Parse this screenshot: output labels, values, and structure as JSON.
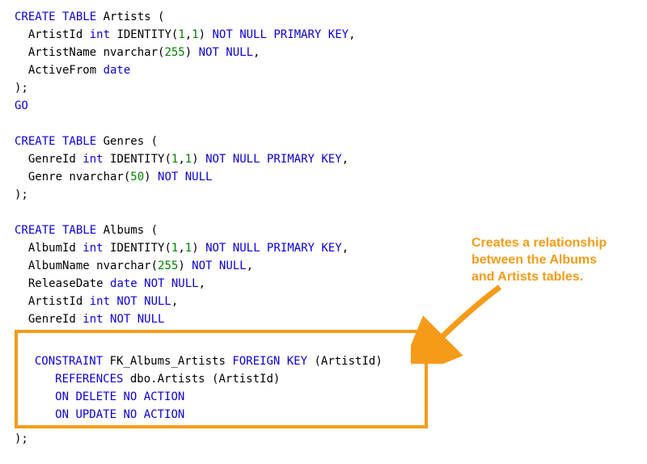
{
  "code": {
    "l1": {
      "a": "CREATE TABLE",
      "b": " Artists ("
    },
    "l2": {
      "a": "  ArtistId ",
      "b": "int",
      "c": " IDENTITY(",
      "d": "1",
      "e": ",",
      "f": "1",
      "g": ") ",
      "h": "NOT NULL PRIMARY KEY",
      "i": ","
    },
    "l3": {
      "a": "  ArtistName nvarchar(",
      "b": "255",
      "c": ") ",
      "d": "NOT NULL",
      "e": ","
    },
    "l4": {
      "a": "  ActiveFrom ",
      "b": "date"
    },
    "l5": ");",
    "l6": "GO",
    "blank1": " ",
    "l7": {
      "a": "CREATE TABLE",
      "b": " Genres ("
    },
    "l8": {
      "a": "  GenreId ",
      "b": "int",
      "c": " IDENTITY(",
      "d": "1",
      "e": ",",
      "f": "1",
      "g": ") ",
      "h": "NOT NULL PRIMARY KEY",
      "i": ","
    },
    "l9": {
      "a": "  Genre nvarchar(",
      "b": "50",
      "c": ") ",
      "d": "NOT NULL"
    },
    "l10": ");",
    "blank2": " ",
    "l11": {
      "a": "CREATE TABLE",
      "b": " Albums ("
    },
    "l12": {
      "a": "  AlbumId ",
      "b": "int",
      "c": " IDENTITY(",
      "d": "1",
      "e": ",",
      "f": "1",
      "g": ") ",
      "h": "NOT NULL PRIMARY KEY",
      "i": ","
    },
    "l13": {
      "a": "  AlbumName nvarchar(",
      "b": "255",
      "c": ") ",
      "d": "NOT NULL",
      "e": ","
    },
    "l14": {
      "a": "  ReleaseDate ",
      "b": "date NOT NULL",
      "c": ","
    },
    "l15": {
      "a": "  ArtistId ",
      "b": "int NOT NULL",
      "c": ","
    },
    "l16": {
      "a": "  GenreId ",
      "b": "int NOT NULL"
    },
    "blank3": " ",
    "l17": {
      "a": "  ",
      "b": "CONSTRAINT",
      "c": " FK_Albums_Artists ",
      "d": "FOREIGN KEY",
      "e": " (ArtistId)"
    },
    "l18": {
      "a": "     ",
      "b": "REFERENCES",
      "c": " dbo.Artists (ArtistId)"
    },
    "l19": {
      "a": "     ",
      "b": "ON DELETE NO ACTION"
    },
    "l20": {
      "a": "     ",
      "b": "ON UPDATE NO ACTION"
    },
    "l21": ");"
  },
  "annotation": {
    "line1": "Creates a relationship",
    "line2": "between the Albums",
    "line3": "and Artists tables."
  }
}
